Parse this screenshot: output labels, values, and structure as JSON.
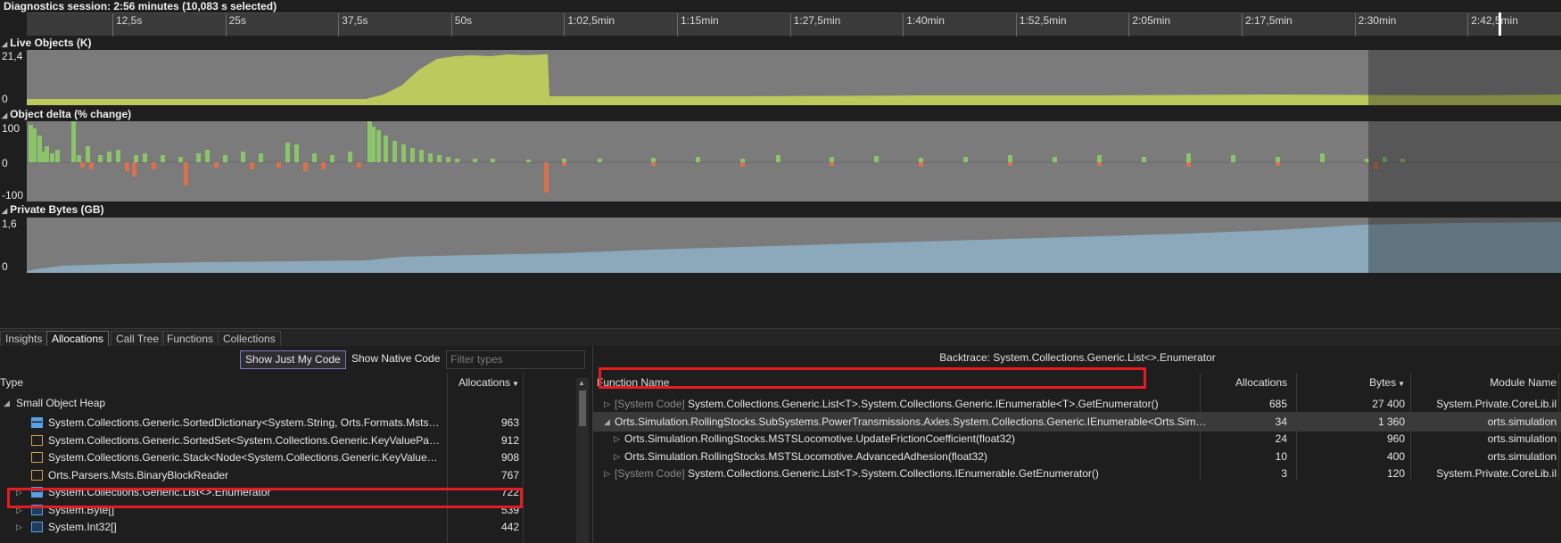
{
  "session": {
    "title": "Diagnostics session: 2:56 minutes (10,083 s selected)"
  },
  "ruler": {
    "ticks": [
      "12,5s",
      "25s",
      "37,5s",
      "50s",
      "1:02,5min",
      "1:15min",
      "1:27,5min",
      "1:40min",
      "1:52,5min",
      "2:05min",
      "2:17,5min",
      "2:30min",
      "2:42,5min"
    ]
  },
  "graphs": {
    "live_objects": {
      "title": "Live Objects (K)",
      "y_max": "21,4",
      "y_min": "0",
      "color": "#bcc95c"
    },
    "object_delta": {
      "title": "Object delta (% change)",
      "y_max": "100",
      "y_mid": "0",
      "y_min": "-100",
      "pos_color": "#8cc46a",
      "neg_color": "#d9714f"
    },
    "private_bytes": {
      "title": "Private Bytes (GB)",
      "y_max": "1,6",
      "y_min": "0",
      "color": "#8ba9ba"
    }
  },
  "tabs": [
    "Insights",
    "Allocations",
    "Call Tree",
    "Functions",
    "Collections"
  ],
  "active_tab": "Allocations",
  "left": {
    "show_just_my_code": "Show Just My Code",
    "show_native_code": "Show Native Code",
    "filter_placeholder": "Filter types",
    "col_type": "Type",
    "col_allocations": "Allocations",
    "group": "Small Object Heap",
    "rows": [
      {
        "name": "System.Collections.Generic.SortedDictionary<System.String, Orts.Formats.Msts.Sig...",
        "alloc": "963",
        "icon": "class-icon",
        "expandable": false
      },
      {
        "name": "System.Collections.Generic.SortedSet<System.Collections.Generic.KeyValuePair<Sy...",
        "alloc": "912",
        "icon": "generic-class-icon",
        "expandable": false
      },
      {
        "name": "System.Collections.Generic.Stack<Node<System.Collections.Generic.KeyValuePair...",
        "alloc": "908",
        "icon": "generic-class-icon",
        "expandable": false
      },
      {
        "name": "Orts.Parsers.Msts.BinaryBlockReader",
        "alloc": "767",
        "icon": "generic-class-icon",
        "expandable": false
      },
      {
        "name": "System.Collections.Generic.List<>.Enumerator",
        "alloc": "722",
        "icon": "class-icon",
        "expandable": true
      },
      {
        "name": "System.Byte[]",
        "alloc": "539",
        "icon": "array-icon",
        "expandable": true
      },
      {
        "name": "System.Int32[]",
        "alloc": "442",
        "icon": "array-icon",
        "expandable": true
      }
    ]
  },
  "right": {
    "title": "Backtrace: System.Collections.Generic.List<>.Enumerator",
    "col_function": "Function Name",
    "col_allocations": "Allocations",
    "col_bytes": "Bytes",
    "col_module": "Module Name",
    "rows": [
      {
        "prefix": "[System Code] ",
        "fn": "System.Collections.Generic.List<T>.System.Collections.Generic.IEnumerable<T>.GetEnumerator()",
        "alloc": "685",
        "bytes": "27 400",
        "module": "System.Private.CoreLib.il",
        "expanded": false,
        "indent": 0
      },
      {
        "prefix": "",
        "fn": "Orts.Simulation.RollingStocks.SubSystems.PowerTransmissions.Axles.System.Collections.Generic.IEnumerable<Orts.Simulati...",
        "alloc": "34",
        "bytes": "1 360",
        "module": "orts.simulation",
        "expanded": true,
        "indent": 0
      },
      {
        "prefix": "",
        "fn": "Orts.Simulation.RollingStocks.MSTSLocomotive.UpdateFrictionCoefficient(float32)",
        "alloc": "24",
        "bytes": "960",
        "module": "orts.simulation",
        "expanded": false,
        "indent": 1
      },
      {
        "prefix": "",
        "fn": "Orts.Simulation.RollingStocks.MSTSLocomotive.AdvancedAdhesion(float32)",
        "alloc": "10",
        "bytes": "400",
        "module": "orts.simulation",
        "expanded": false,
        "indent": 1
      },
      {
        "prefix": "[System Code] ",
        "fn": "System.Collections.Generic.List<T>.System.Collections.IEnumerable.GetEnumerator()",
        "alloc": "3",
        "bytes": "120",
        "module": "System.Private.CoreLib.il",
        "expanded": false,
        "indent": 0
      }
    ]
  }
}
